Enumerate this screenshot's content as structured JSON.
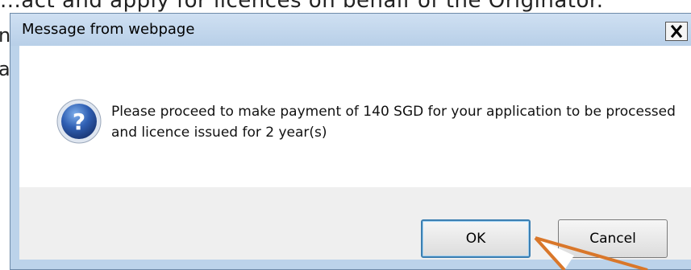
{
  "background": {
    "top_line": "...act and apply for licences on behalf of the Originator.",
    "left_chars": [
      "n",
      "a"
    ]
  },
  "dialog": {
    "title": "Message from webpage",
    "close_symbol": "×",
    "icon": "question-icon",
    "message": "Please proceed to make payment of 140 SGD for your application to be processed and licence issued for 2 year(s)",
    "buttons": {
      "ok": "OK",
      "cancel": "Cancel"
    }
  },
  "annotation": {
    "arrow_color": "#d9772a",
    "target": "OK button"
  }
}
